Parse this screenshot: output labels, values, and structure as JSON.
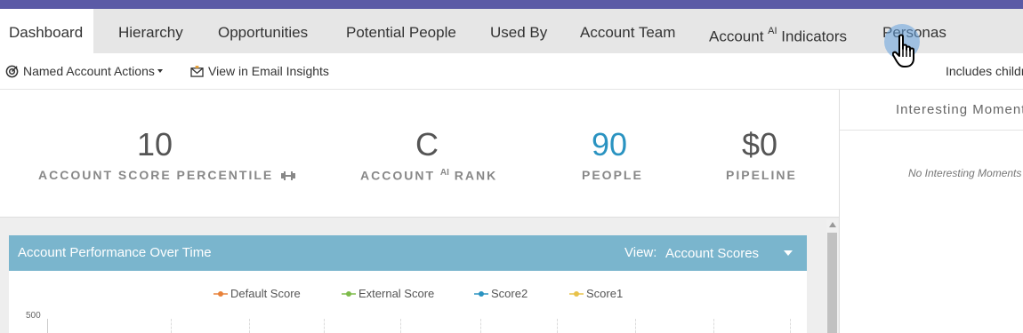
{
  "tabs": [
    {
      "label": "Dashboard",
      "active": true
    },
    {
      "label": "Hierarchy"
    },
    {
      "label": "Opportunities"
    },
    {
      "label": "Potential People"
    },
    {
      "label": "Used By"
    },
    {
      "label": "Account Team"
    },
    {
      "label": "Account",
      "sup": "AI",
      "suffix": " Indicators"
    },
    {
      "label": "Personas"
    }
  ],
  "toolbar": {
    "named_actions": "Named Account Actions",
    "email_insights": "View in Email Insights",
    "includes_children": "Includes childr"
  },
  "stats": [
    {
      "value": "10",
      "label": "ACCOUNT SCORE PERCENTILE"
    },
    {
      "value": "C",
      "label_prefix": "ACCOUNT ",
      "label_sup": "AI",
      "label_suffix": " RANK"
    },
    {
      "value": "90",
      "label": "PEOPLE"
    },
    {
      "value": "$0",
      "label": "PIPELINE"
    }
  ],
  "performance": {
    "title": "Account Performance Over Time",
    "view_label": "View:",
    "view_value": "Account Scores"
  },
  "chart_data": {
    "type": "line",
    "series": [
      {
        "name": "Default Score",
        "color": "#e8823a"
      },
      {
        "name": "External Score",
        "color": "#7dbb4a"
      },
      {
        "name": "Score2",
        "color": "#2a93c1"
      },
      {
        "name": "Score1",
        "color": "#e8c24a"
      }
    ],
    "ytick_top": "500"
  },
  "sidebar": {
    "title": "Interesting Moment",
    "empty": "No Interesting Moments"
  },
  "colors": {
    "brand_bar": "#5b5aa6",
    "panel_header": "#7ab5cd",
    "people_value": "#2a93c1"
  }
}
